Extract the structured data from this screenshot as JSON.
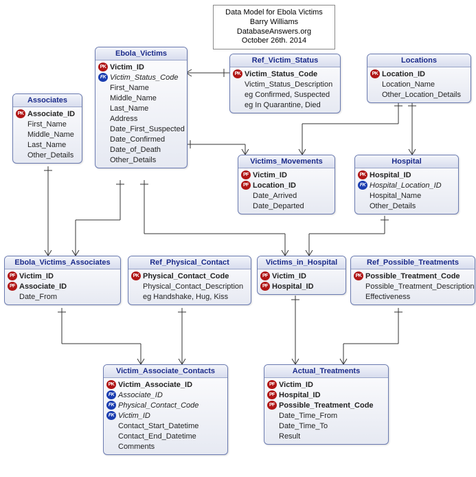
{
  "info": {
    "line1": "Data Model for Ebola Victims",
    "line2": "Barry Williams",
    "line3": "DatabaseAnswers.org",
    "line4": "October 26th. 2014"
  },
  "entities": {
    "ebola_victims": {
      "title": "Ebola_Victims",
      "fields": [
        {
          "key": "PK",
          "label": "Victim_ID",
          "bold": true
        },
        {
          "key": "FK",
          "label": "Victim_Status_Code",
          "italic": true
        },
        {
          "key": "",
          "label": "First_Name"
        },
        {
          "key": "",
          "label": "Middle_Name"
        },
        {
          "key": "",
          "label": "Last_Name"
        },
        {
          "key": "",
          "label": "Address"
        },
        {
          "key": "",
          "label": "Date_First_Suspected"
        },
        {
          "key": "",
          "label": "Date_Confirmed"
        },
        {
          "key": "",
          "label": "Date_of_Death"
        },
        {
          "key": "",
          "label": "Other_Details"
        }
      ]
    },
    "associates": {
      "title": "Associates",
      "fields": [
        {
          "key": "PK",
          "label": "Associate_ID",
          "bold": true
        },
        {
          "key": "",
          "label": "First_Name"
        },
        {
          "key": "",
          "label": "Middle_Name"
        },
        {
          "key": "",
          "label": "Last_Name"
        },
        {
          "key": "",
          "label": "Other_Details"
        }
      ]
    },
    "ref_victim_status": {
      "title": "Ref_Victim_Status",
      "fields": [
        {
          "key": "PK",
          "label": "Victim_Status_Code",
          "bold": true
        },
        {
          "key": "",
          "label": "Victim_Status_Description"
        },
        {
          "key": "",
          "label": "eg Confirmed, Suspected"
        },
        {
          "key": "",
          "label": "eg In Quarantine, Died"
        }
      ]
    },
    "locations": {
      "title": "Locations",
      "fields": [
        {
          "key": "PK",
          "label": "Location_ID",
          "bold": true
        },
        {
          "key": "",
          "label": "Location_Name"
        },
        {
          "key": "",
          "label": "Other_Location_Details"
        }
      ]
    },
    "victims_movements": {
      "title": "Victims_Movements",
      "fields": [
        {
          "key": "PF",
          "label": "Victim_ID",
          "bold": true
        },
        {
          "key": "PF",
          "label": "Location_ID",
          "bold": true
        },
        {
          "key": "",
          "label": "Date_Arrived"
        },
        {
          "key": "",
          "label": "Date_Departed"
        }
      ]
    },
    "hospital": {
      "title": "Hospital",
      "fields": [
        {
          "key": "PK",
          "label": "Hospital_ID",
          "bold": true
        },
        {
          "key": "FK",
          "label": "Hospital_Location_ID",
          "italic": true
        },
        {
          "key": "",
          "label": "Hospital_Name"
        },
        {
          "key": "",
          "label": "Other_Details"
        }
      ]
    },
    "ebola_victims_associates": {
      "title": "Ebola_Victims_Associates",
      "fields": [
        {
          "key": "PF",
          "label": "Victim_ID",
          "bold": true
        },
        {
          "key": "PF",
          "label": "Associate_ID",
          "bold": true
        },
        {
          "key": "",
          "label": "Date_From"
        }
      ]
    },
    "ref_physical_contact": {
      "title": "Ref_Physical_Contact",
      "fields": [
        {
          "key": "PK",
          "label": "Physical_Contact_Code",
          "bold": true
        },
        {
          "key": "",
          "label": "Physical_Contact_Description"
        },
        {
          "key": "",
          "label": "eg Handshake, Hug, Kiss"
        }
      ]
    },
    "victims_in_hospital": {
      "title": "Victims_in_Hospital",
      "fields": [
        {
          "key": "PF",
          "label": "Victim_ID",
          "bold": true
        },
        {
          "key": "PF",
          "label": "Hospital_ID",
          "bold": true
        }
      ]
    },
    "ref_possible_treatments": {
      "title": "Ref_Possible_Treatments",
      "fields": [
        {
          "key": "PK",
          "label": "Possible_Treatment_Code",
          "bold": true
        },
        {
          "key": "",
          "label": "Possible_Treatment_Description"
        },
        {
          "key": "",
          "label": "Effectiveness"
        }
      ]
    },
    "victim_associate_contacts": {
      "title": "Victim_Associate_Contacts",
      "fields": [
        {
          "key": "PK",
          "label": "Victim_Associate_ID",
          "bold": true
        },
        {
          "key": "FK",
          "label": "Associate_ID",
          "italic": true
        },
        {
          "key": "FK",
          "label": "Physical_Contact_Code",
          "italic": true
        },
        {
          "key": "FK",
          "label": "Victim_ID",
          "italic": true
        },
        {
          "key": "",
          "label": "Contact_Start_Datetime"
        },
        {
          "key": "",
          "label": "Contact_End_Datetime"
        },
        {
          "key": "",
          "label": "Comments"
        }
      ]
    },
    "actual_treatments": {
      "title": "Actual_Treatments",
      "fields": [
        {
          "key": "PF",
          "label": "Victim_ID",
          "bold": true
        },
        {
          "key": "PF",
          "label": "Hospital_ID",
          "bold": true
        },
        {
          "key": "PF",
          "label": "Possible_Treatment_Code",
          "bold": true
        },
        {
          "key": "",
          "label": "Date_Time_From"
        },
        {
          "key": "",
          "label": "Date_Time_To"
        },
        {
          "key": "",
          "label": "Result"
        }
      ]
    }
  }
}
